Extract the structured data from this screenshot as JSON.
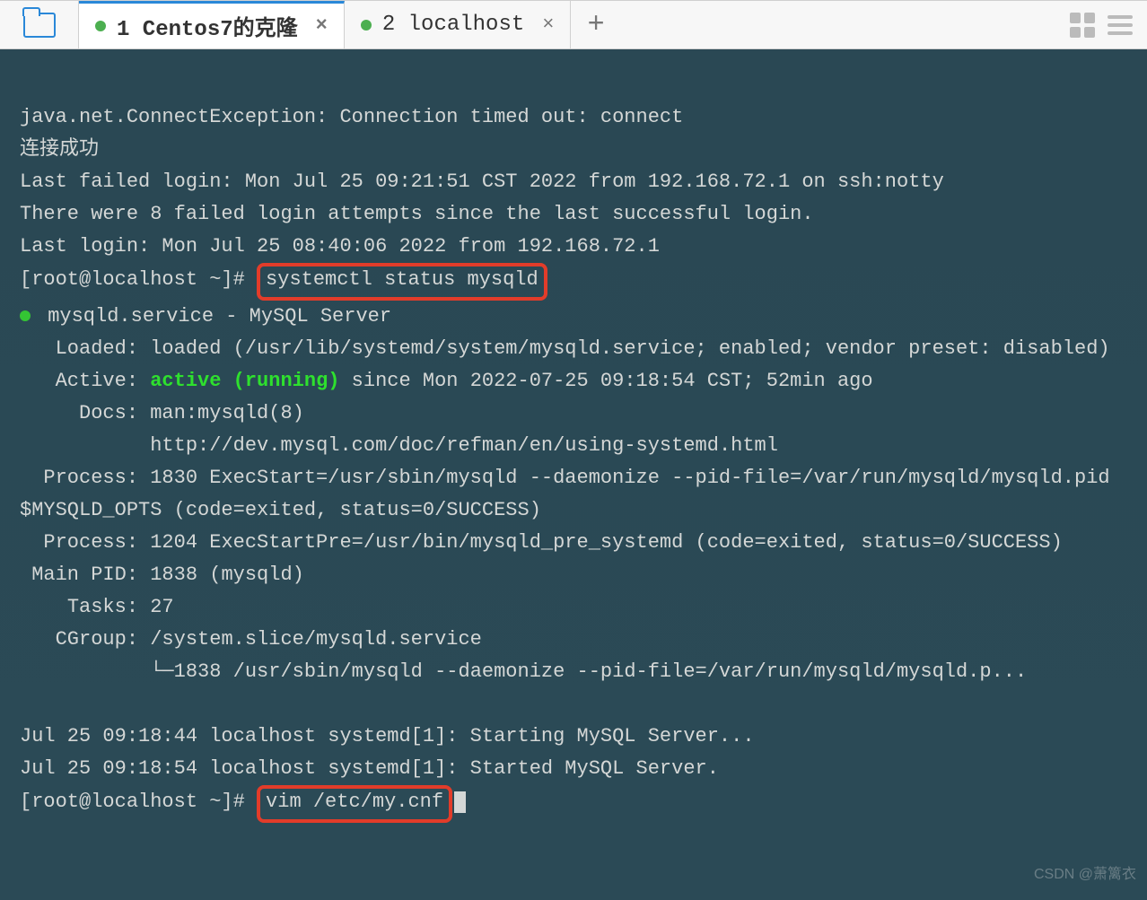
{
  "tabs": [
    {
      "label": "1 Centos7的克隆",
      "active": true
    },
    {
      "label": "2 localhost",
      "active": false
    }
  ],
  "terminal": {
    "line1": "java.net.ConnectException: Connection timed out: connect",
    "line2": "连接成功",
    "line3": "Last failed login: Mon Jul 25 09:21:51 CST 2022 from 192.168.72.1 on ssh:notty",
    "line4": "There were 8 failed login attempts since the last successful login.",
    "line5": "Last login: Mon Jul 25 08:40:06 2022 from 192.168.72.1",
    "prompt1_a": "[root@localhost ~]# ",
    "cmd1": "systemctl status mysqld",
    "svc_line": " mysqld.service - MySQL Server",
    "loaded": "   Loaded: loaded (/usr/lib/systemd/system/mysqld.service; enabled; vendor preset: disabled)",
    "active_pre": "   Active: ",
    "active_state": "active (running)",
    "active_post": " since Mon 2022-07-25 09:18:54 CST; 52min ago",
    "docs1": "     Docs: man:mysqld(8)",
    "docs2": "           http://dev.mysql.com/doc/refman/en/using-systemd.html",
    "proc1": "  Process: 1830 ExecStart=/usr/sbin/mysqld --daemonize --pid-file=/var/run/mysqld/mysqld.pid $MYSQLD_OPTS (code=exited, status=0/SUCCESS)",
    "proc2": "  Process: 1204 ExecStartPre=/usr/bin/mysqld_pre_systemd (code=exited, status=0/SUCCESS)",
    "mainpid": " Main PID: 1838 (mysqld)",
    "tasks": "    Tasks: 27",
    "cgroup": "   CGroup: /system.slice/mysqld.service",
    "cgline": "           └─1838 /usr/sbin/mysqld --daemonize --pid-file=/var/run/mysqld/mysqld.p...",
    "log1": "Jul 25 09:18:44 localhost systemd[1]: Starting MySQL Server...",
    "log2": "Jul 25 09:18:54 localhost systemd[1]: Started MySQL Server.",
    "prompt2_a": "[root@localhost ~]# ",
    "cmd2": "vim /etc/my.cnf"
  },
  "watermark": "CSDN @萧篱衣"
}
